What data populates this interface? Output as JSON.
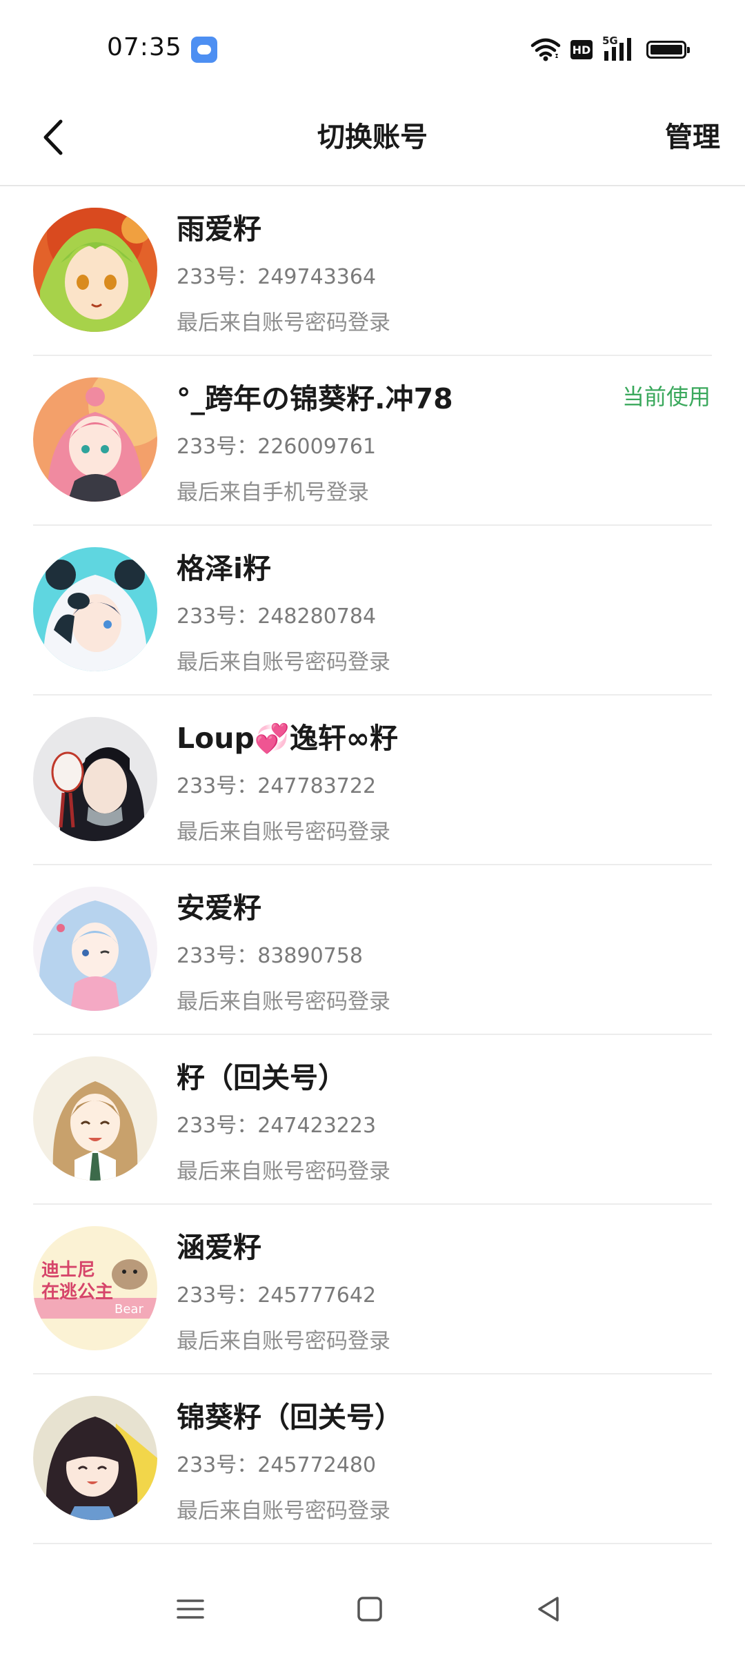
{
  "status_bar": {
    "time": "07:35",
    "network": "5G",
    "hd": "HD"
  },
  "header": {
    "title": "切换账号",
    "manage_label": "管理",
    "back_icon": "chevron-left-icon"
  },
  "accounts": [
    {
      "name": "雨爱籽",
      "id_text": "233号：249743364",
      "login_text": "最后来自账号密码登录",
      "current": ""
    },
    {
      "name": "°_跨年の锦葵籽.冲78",
      "id_text": "233号：226009761",
      "login_text": "最后来自手机号登录",
      "current": "当前使用"
    },
    {
      "name": "格泽i籽",
      "id_text": "233号：248280784",
      "login_text": "最后来自账号密码登录",
      "current": ""
    },
    {
      "name": "Loup💞逸轩∞籽",
      "id_text": "233号：247783722",
      "login_text": "最后来自账号密码登录",
      "current": ""
    },
    {
      "name": "安爱籽",
      "id_text": "233号：83890758",
      "login_text": "最后来自账号密码登录",
      "current": ""
    },
    {
      "name": "籽（回关号）",
      "id_text": "233号：247423223",
      "login_text": "最后来自账号密码登录",
      "current": ""
    },
    {
      "name": "涵爱籽",
      "id_text": "233号：245777642",
      "login_text": "最后来自账号密码登录",
      "current": ""
    },
    {
      "name": "锦葵籽（回关号）",
      "id_text": "233号：245772480",
      "login_text": "最后来自账号密码登录",
      "current": ""
    }
  ],
  "avatar_texts": {
    "a7_line1": "迪士尼",
    "a7_line2": "在逃公主",
    "a7_tag": "Bear"
  },
  "colors": {
    "accent_green": "#3aa85c",
    "app_icon_blue": "#4d8ff2"
  },
  "nav_icons": [
    "menu-icon",
    "home-square-icon",
    "back-triangle-icon"
  ]
}
